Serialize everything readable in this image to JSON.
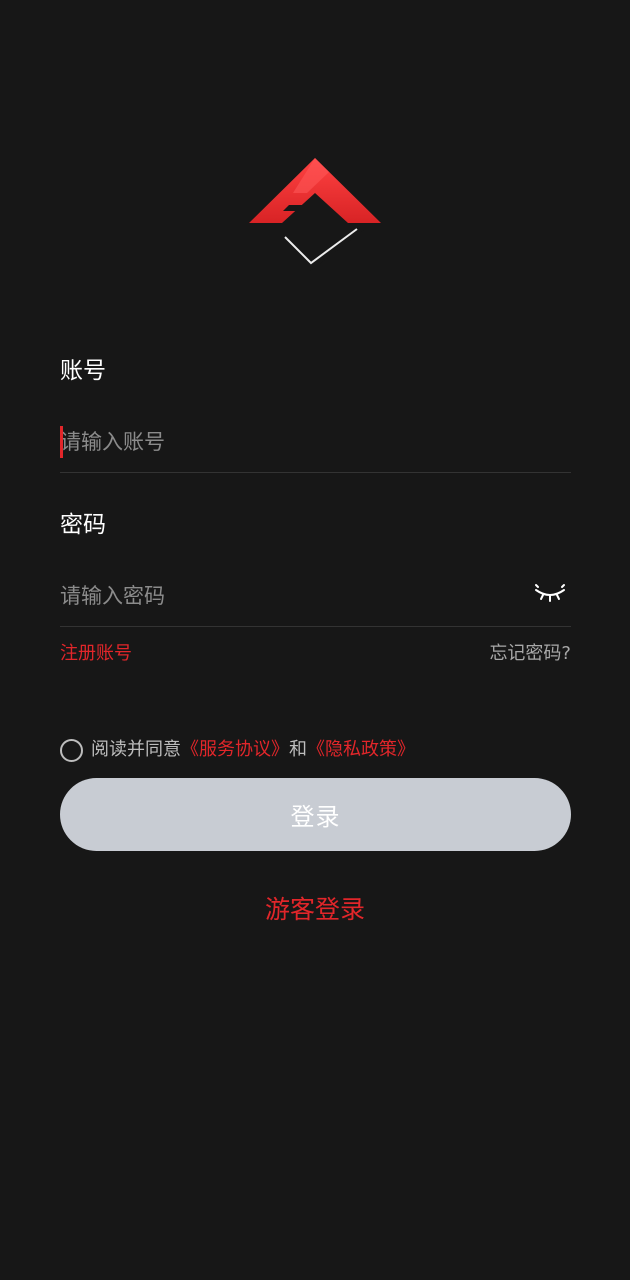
{
  "logo": {
    "name": "app-logo",
    "colors": {
      "red": "#ee3334",
      "silver": "#d6d6d6"
    }
  },
  "account": {
    "label": "账号",
    "placeholder": "请输入账号"
  },
  "password": {
    "label": "密码",
    "placeholder": "请输入密码",
    "toggle_icon": "eye-closed-icon"
  },
  "links": {
    "register": "注册账号",
    "forgot": "忘记密码?"
  },
  "agreement": {
    "prefix": "阅读并同意",
    "service": "《服务协议》",
    "and": "和",
    "privacy": "《隐私政策》",
    "checked": false
  },
  "login": {
    "label": "登录"
  },
  "guest": {
    "label": "游客登录"
  },
  "colors": {
    "background": "#171717",
    "accent": "#e2262a",
    "button": "#c8ccd3",
    "placeholder": "#8b8b8b",
    "divider": "#333333"
  }
}
